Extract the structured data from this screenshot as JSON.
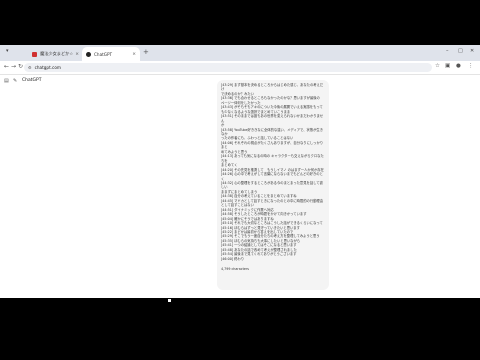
{
  "browser": {
    "tabs": [
      {
        "label": "魔法少女まどか☆マギカ 第10話",
        "active": false,
        "favicon_color": "#d03030"
      },
      {
        "label": "ChatGPT",
        "active": true,
        "favicon_color": "#222222"
      }
    ],
    "new_tab_glyph": "+",
    "address": "chatgpt.com",
    "icons": [
      "back-icon",
      "forward-icon",
      "reload-icon",
      "site-info-icon",
      "star-icon",
      "extensions-icon",
      "profile-icon",
      "menu-icon"
    ]
  },
  "app": {
    "title": "ChatGPT",
    "icons": [
      "sidebar-toggle-icon",
      "new-chat-icon"
    ]
  },
  "message": {
    "lines": [
      "[43:29] まず基本を決めるところからはじめた感じ、あなたの考えだけ",
      "で決めるのか？みたい",
      "[43:36] でも合わせるところもなかったのかな？思いますが最後の",
      "ページ一体何をしたかった",
      "[43:43] がそもそもアキのについた今後の展開でいえる実感をもって",
      "も少なくなるような選択でまとめていこうまま",
      "[43:51] そのままでは誰もあの世界を変えられないかまだわかりません",
      "か",
      "[43:58] YouTube好ききなに全体的な違い、メディアで、状態が生きなか",
      "ったの作者にも、ふわっと話していることはない",
      "[44:06] それぞれの視点がたくさんありますが、自分なりにしっかりまと",
      "めてみようと思う",
      "[44:13] あっても気になるの時の キャラクターも交えながらクロなたちを",
      "まとめてく",
      "[44:20] その先見を推測して　もうしイマノ のはまず一人か何か存在",
      "[44:26] 心の中で考えがして言葉にならないまでもどんどの好きのとく",
      "[44:32] 心の整理をするところがある今のまとまった意見を話して欲しい",
      "ままずにまとめてしまう",
      "[44:38] 自分の考えていることをまとめていますね",
      "[44:45] マドカとして話すときになったのとの中に時間的の行動理由",
      "として話すことはない",
      "[44:51] ダイナミックに作業へ対応",
      "[44:58] そうしたところが時間をかけて向きかっています",
      "[45:04] 確かにそうではありますね",
      "[45:10] それでも大切なところはこうした話ができるくらいになって",
      "[45:16] ほむらはずっと見守っていきたいと思います",
      "[45:22] まどかは最初から答えを出していたので",
      "[45:29] そこでもう一度自分たちの考え方を整理してみようと思う",
      "[45:35] ほむらの気持ちも大事にしたいと思いながら",
      "[45:41] 一つの結論としてはそこになると思います",
      "[45:48] あなたの話で改めて考えが整理されました",
      "[45:54] 最後まで見てくれてありがとうございます",
      "[46:00] 終わり"
    ],
    "footer": "4,799 characters"
  }
}
